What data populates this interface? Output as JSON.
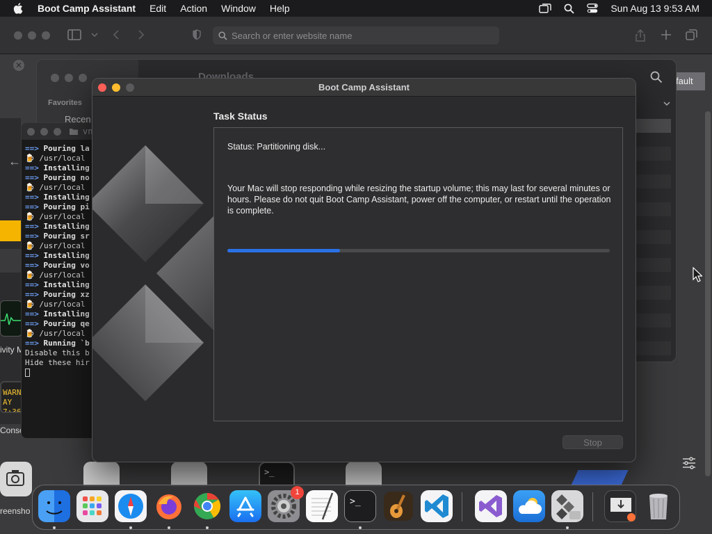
{
  "menubar": {
    "app_name": "Boot Camp Assistant",
    "menus": [
      "Edit",
      "Action",
      "Window",
      "Help"
    ],
    "datetime": "Sun Aug 13  9:53 AM"
  },
  "browser": {
    "address_placeholder": "Search or enter website name",
    "default_label": "fault"
  },
  "finder": {
    "favorites_label": "Favorites",
    "recents_label": "Recen",
    "title": "Downloads"
  },
  "terminal": {
    "title": "vn",
    "lines": [
      {
        "arrow": "==>",
        "text": "Pouring la"
      },
      {
        "icon": "🍺",
        "text": "/usr/local"
      },
      {
        "arrow": "==>",
        "text": "Installing"
      },
      {
        "arrow": "==>",
        "text": "Pouring no"
      },
      {
        "icon": "🍺",
        "text": "/usr/local"
      },
      {
        "arrow": "==>",
        "text": "Installing"
      },
      {
        "arrow": "==>",
        "text": "Pouring pi"
      },
      {
        "icon": "🍺",
        "text": "/usr/local"
      },
      {
        "arrow": "==>",
        "text": "Installing"
      },
      {
        "arrow": "==>",
        "text": "Pouring sr"
      },
      {
        "icon": "🍺",
        "text": "/usr/local"
      },
      {
        "arrow": "==>",
        "text": "Installing"
      },
      {
        "arrow": "==>",
        "text": "Pouring vo"
      },
      {
        "icon": "🍺",
        "text": "/usr/local"
      },
      {
        "arrow": "==>",
        "text": "Installing"
      },
      {
        "arrow": "==>",
        "text": "Pouring xz"
      },
      {
        "icon": "🍺",
        "text": "/usr/local"
      },
      {
        "arrow": "==>",
        "text": "Installing"
      },
      {
        "arrow": "==>",
        "text": "Pouring qe"
      },
      {
        "icon": "🍺",
        "text": "/usr/local"
      },
      {
        "arrow": "==>",
        "text": "Running `b"
      },
      {
        "plain": "Disable this b"
      },
      {
        "plain": "Hide these hir"
      }
    ]
  },
  "left_labels": {
    "activity": "ivity M",
    "warning_line1": "WARNIN",
    "warning_line2": "AY 7:36",
    "console": "Console",
    "screenshot": "reensho"
  },
  "dialog": {
    "title": "Boot Camp Assistant",
    "heading": "Task Status",
    "status": "Status: Partitioning disk...",
    "message": "Your Mac will stop responding while resizing the startup volume; this may last for several minutes or hours. Please do not quit Boot Camp Assistant, power off the computer, or restart until the operation is complete.",
    "progress_fraction": 0.295,
    "stop_label": "Stop"
  },
  "dock": {
    "items": [
      {
        "name": "finder",
        "running": true
      },
      {
        "name": "launchpad",
        "running": false
      },
      {
        "name": "safari",
        "running": true
      },
      {
        "name": "firefox",
        "running": true
      },
      {
        "name": "chrome",
        "running": true
      },
      {
        "name": "app-store",
        "running": false
      },
      {
        "name": "system-settings",
        "running": false,
        "badge": "1"
      },
      {
        "name": "textedit",
        "running": false
      },
      {
        "name": "terminal",
        "running": true
      },
      {
        "name": "garageband",
        "running": false
      },
      {
        "name": "vscode",
        "running": false
      },
      {
        "name": "visual-studio",
        "running": false
      },
      {
        "name": "cloud-app",
        "running": false
      },
      {
        "name": "boot-camp-assistant",
        "running": true
      },
      {
        "name": "downloads-stack",
        "running": false
      },
      {
        "name": "trash",
        "running": false
      }
    ]
  },
  "colors": {
    "accent_blue": "#2b71e6",
    "close_red": "#fe5f57",
    "minimize_yellow": "#febc2e",
    "badge_red": "#f0453b"
  }
}
